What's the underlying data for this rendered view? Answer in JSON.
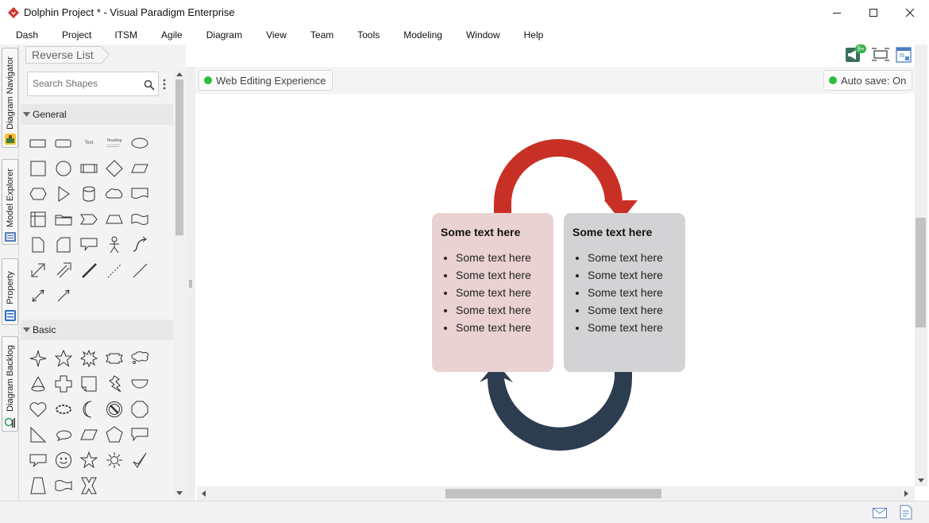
{
  "window": {
    "title": "Dolphin Project * - Visual Paradigm Enterprise",
    "controls": {
      "minimize": "—",
      "maximize": "☐",
      "close": "✕"
    }
  },
  "menu": [
    "Dash",
    "Project",
    "ITSM",
    "Agile",
    "Diagram",
    "View",
    "Team",
    "Tools",
    "Modeling",
    "Window",
    "Help"
  ],
  "breadcrumb": "Reverse List",
  "toolbar": {
    "notification_badge": "9+"
  },
  "side_tabs": [
    "Diagram Navigator",
    "Model Explorer",
    "Property",
    "Diagram Backlog"
  ],
  "shapes_panel": {
    "search_placeholder": "Search Shapes",
    "sections": [
      {
        "title": "General",
        "tiny_labels": {
          "text": "Text",
          "heading": "Heading"
        }
      },
      {
        "title": "Basic"
      }
    ]
  },
  "canvas": {
    "web_editing": "Web Editing Experience",
    "autosave": "Auto save: On"
  },
  "diagram": {
    "arrow_top_color": "#c93025",
    "arrow_bottom_color": "#2d3d50",
    "cards": [
      {
        "title": "Some text here",
        "bg": "#ebd2d2",
        "items": [
          "Some text here",
          "Some text here",
          "Some text here",
          "Some text here",
          "Some text here"
        ]
      },
      {
        "title": "Some text here",
        "bg": "#d3d3d5",
        "items": [
          "Some text here",
          "Some text here",
          "Some text here",
          "Some text here",
          "Some text here"
        ]
      }
    ]
  },
  "colors": {
    "accent_green": "#2bbf3a",
    "logo_red": "#d0342c"
  }
}
